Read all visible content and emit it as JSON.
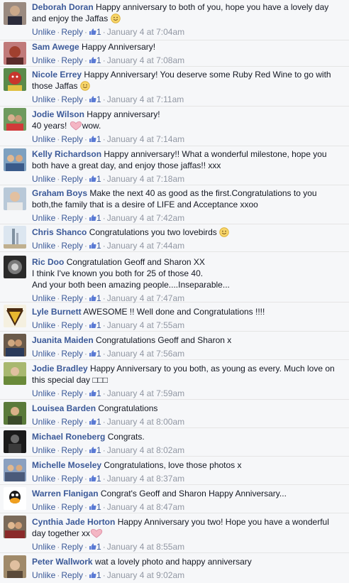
{
  "actions": {
    "unlike": "Unlike",
    "reply": "Reply",
    "separator": "·"
  },
  "colors": {
    "link": "#3b5998",
    "meta": "#9197a3",
    "text": "#141823",
    "background": "#f6f7f9"
  },
  "comments": [
    {
      "author": "Deborah Doran",
      "text": "Happy anniversary to both of you, hope you have a lovely day",
      "text2": "and enjoy the Jaffas",
      "emoji": "smile-emoji",
      "likes": "1",
      "time": "January 4 at 7:04am"
    },
    {
      "author": "Sam Awege",
      "text": "Happy Anniversary!",
      "likes": "1",
      "time": "January 4 at 7:08am"
    },
    {
      "author": "Nicole Errey",
      "text": "Happy Anniversary! You deserve some Ruby Red Wine to go with",
      "text2": "those Jaffas",
      "emoji": "smile-emoji",
      "likes": "1",
      "time": "January 4 at 7:11am"
    },
    {
      "author": "Jodie Wilson",
      "text": "Happy anniversary!",
      "text2": "40 years!",
      "text2b": "wow.",
      "emoji": "heart-emoji",
      "likes": "1",
      "time": "January 4 at 7:14am"
    },
    {
      "author": "Kelly Richardson",
      "text": "Happy anniversary!! What a wonderful milestone, hope you",
      "text2": "both have a great day, and enjoy those jaffas!! xxx",
      "likes": "1",
      "time": "January 4 at 7:18am"
    },
    {
      "author": "Graham Boys",
      "text": "Make the next 40 as good as the first.Congratulations to you",
      "text2": "both,the family that is a desire of LIFE and Acceptance xxoo",
      "likes": "1",
      "time": "January 4 at 7:42am"
    },
    {
      "author": "Chris Shanco",
      "text": "Congratulations you two lovebirds",
      "emoji": "smile-emoji",
      "likes": "1",
      "time": "January 4 at 7:44am"
    },
    {
      "author": "Ric Doo",
      "text": "Congratulation Geoff and Sharon XX",
      "text2": "I think I've known you both for 25 of those 40.",
      "text3": "And your both been amazing people....Inseparable...",
      "likes": "1",
      "time": "January 4 at 7:47am"
    },
    {
      "author": "Lyle Burnett",
      "text": "AWESOME !! Well done and Congratulations !!!!",
      "likes": "1",
      "time": "January 4 at 7:55am"
    },
    {
      "author": "Juanita Maiden",
      "text": "Congratulations Geoff and Sharon x",
      "likes": "1",
      "time": "January 4 at 7:56am"
    },
    {
      "author": "Jodie Bradley",
      "text": "Happy Anniversary to you both, as young as every. Much love on",
      "text2": "this special day □□□",
      "likes": "1",
      "time": "January 4 at 7:59am"
    },
    {
      "author": "Louisea Barden",
      "text": "Congratulations",
      "likes": "1",
      "time": "January 4 at 8:00am"
    },
    {
      "author": "Michael Roneberg",
      "text": "Congrats.",
      "likes": "1",
      "time": "January 4 at 8:02am"
    },
    {
      "author": "Michelle Moseley",
      "text": "Congratulations, love those photos x",
      "likes": "1",
      "time": "January 4 at 8:37am"
    },
    {
      "author": "Warren Flanigan",
      "text": "Congrat's Geoff and Sharon Happy Anniversary...",
      "likes": "1",
      "time": "January 4 at 8:47am"
    },
    {
      "author": "Cynthia Jade Horton",
      "text": "Happy Anniversary you two! Hope you have a wonderful",
      "text2": "day together xx",
      "emoji": "heart-emoji",
      "likes": "1",
      "time": "January 4 at 8:55am"
    },
    {
      "author": "Peter Wallwork",
      "text": "wat a lovely photo and happy anniversary",
      "likes": "1",
      "time": "January 4 at 9:02am"
    }
  ]
}
